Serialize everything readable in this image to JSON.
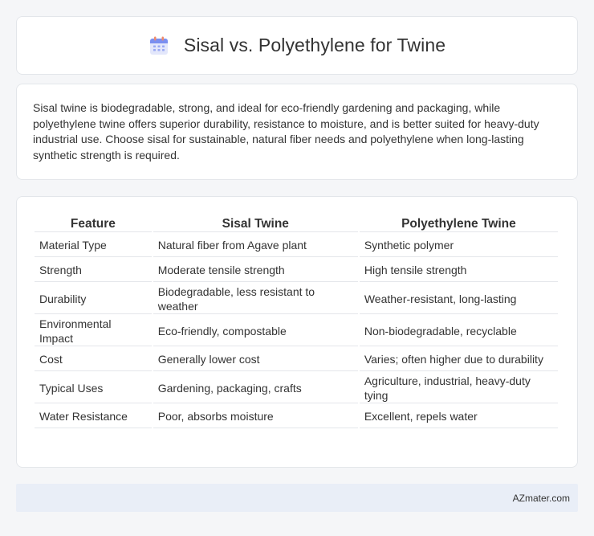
{
  "header": {
    "title": "Sisal vs. Polyethylene for Twine",
    "icon": "calendar-icon"
  },
  "summary": {
    "text": "Sisal twine is biodegradable, strong, and ideal for eco-friendly gardening and packaging, while polyethylene twine offers superior durability, resistance to moisture, and is better suited for heavy-duty industrial use. Choose sisal for sustainable, natural fiber needs and polyethylene when long-lasting synthetic strength is required."
  },
  "table": {
    "headers": [
      "Feature",
      "Sisal Twine",
      "Polyethylene Twine"
    ],
    "rows": [
      [
        "Material Type",
        "Natural fiber from Agave plant",
        "Synthetic polymer"
      ],
      [
        "Strength",
        "Moderate tensile strength",
        "High tensile strength"
      ],
      [
        "Durability",
        "Biodegradable, less resistant to weather",
        "Weather-resistant, long-lasting"
      ],
      [
        "Environmental Impact",
        "Eco-friendly, compostable",
        "Non-biodegradable, recyclable"
      ],
      [
        "Cost",
        "Generally lower cost",
        "Varies; often higher due to durability"
      ],
      [
        "Typical Uses",
        "Gardening, packaging, crafts",
        "Agriculture, industrial, heavy-duty tying"
      ],
      [
        "Water Resistance",
        "Poor, absorbs moisture",
        "Excellent, repels water"
      ]
    ]
  },
  "footer": {
    "brand": "AZmater.com"
  }
}
